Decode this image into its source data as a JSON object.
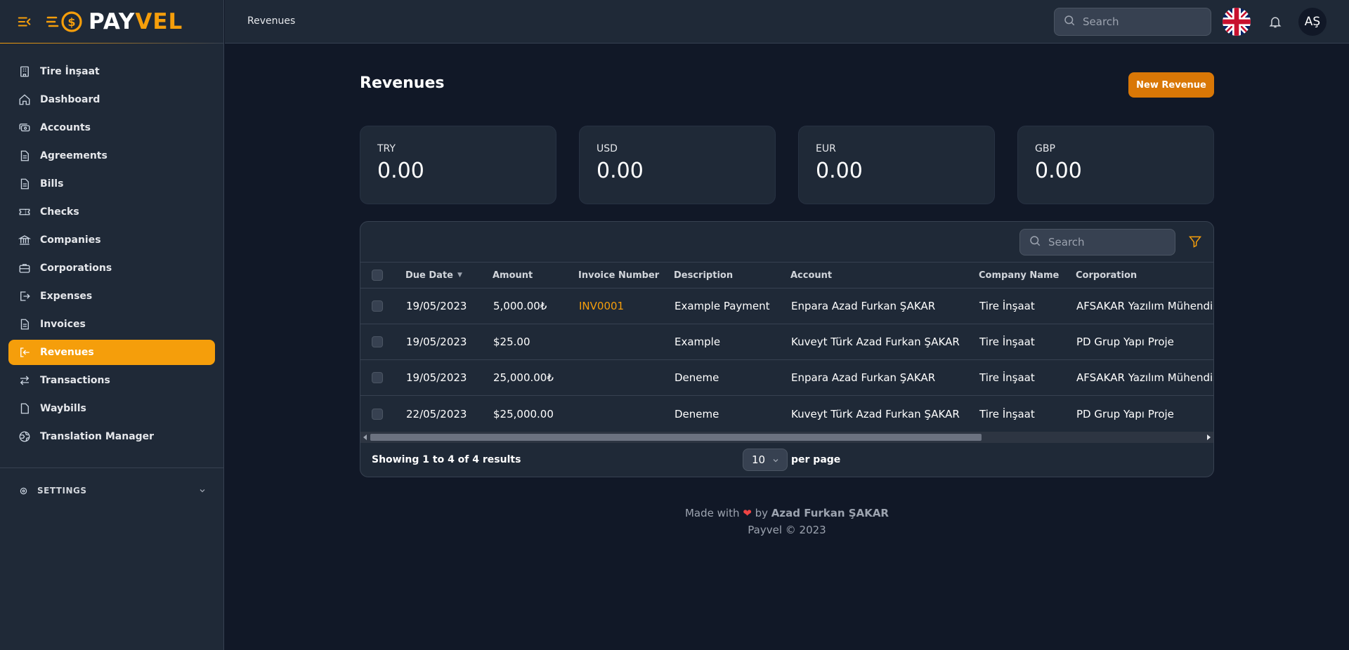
{
  "brand": {
    "pay": "PAY",
    "vel": "VEL"
  },
  "breadcrumb": "Revenues",
  "header": {
    "search_placeholder": "Search",
    "avatar_initials": "AŞ"
  },
  "sidebar": {
    "items": [
      {
        "label": "Tire İnşaat",
        "icon": "building-icon"
      },
      {
        "label": "Dashboard",
        "icon": "home-icon"
      },
      {
        "label": "Accounts",
        "icon": "cash-icon"
      },
      {
        "label": "Agreements",
        "icon": "document-icon"
      },
      {
        "label": "Bills",
        "icon": "document-icon"
      },
      {
        "label": "Checks",
        "icon": "ticket-icon"
      },
      {
        "label": "Companies",
        "icon": "library-icon"
      },
      {
        "label": "Corporations",
        "icon": "briefcase-icon"
      },
      {
        "label": "Expenses",
        "icon": "logout-icon"
      },
      {
        "label": "Invoices",
        "icon": "document-icon"
      },
      {
        "label": "Revenues",
        "icon": "receipt-icon",
        "active": true
      },
      {
        "label": "Transactions",
        "icon": "switch-icon"
      },
      {
        "label": "Waybills",
        "icon": "file-icon"
      },
      {
        "label": "Translation Manager",
        "icon": "globe-icon"
      }
    ],
    "settings_label": "SETTINGS"
  },
  "page": {
    "title": "Revenues",
    "new_button": "New Revenue"
  },
  "stats": [
    {
      "currency": "TRY",
      "value": "0.00"
    },
    {
      "currency": "USD",
      "value": "0.00"
    },
    {
      "currency": "EUR",
      "value": "0.00"
    },
    {
      "currency": "GBP",
      "value": "0.00"
    }
  ],
  "table": {
    "search_placeholder": "Search",
    "columns": [
      "Due Date",
      "Amount",
      "Invoice Number",
      "Description",
      "Account",
      "Company Name",
      "Corporation"
    ],
    "rows": [
      [
        "19/05/2023",
        "5,000.00₺",
        "INV0001",
        "Example Payment",
        "Enpara Azad Furkan ŞAKAR",
        "Tire İnşaat",
        "AFSAKAR Yazılım Mühendis"
      ],
      [
        "19/05/2023",
        "$25.00",
        "",
        "Example",
        "Kuveyt Türk Azad Furkan ŞAKAR",
        "Tire İnşaat",
        "PD Grup Yapı Proje"
      ],
      [
        "19/05/2023",
        "25,000.00₺",
        "",
        "Deneme",
        "Enpara Azad Furkan ŞAKAR",
        "Tire İnşaat",
        "AFSAKAR Yazılım Mühendis"
      ],
      [
        "22/05/2023",
        "$25,000.00",
        "",
        "Deneme",
        "Kuveyt Türk Azad Furkan ŞAKAR",
        "Tire İnşaat",
        "PD Grup Yapı Proje"
      ]
    ],
    "showing": "Showing 1 to 4 of 4 results",
    "per_page_value": "10",
    "per_page_label": "per page"
  },
  "footer": {
    "made_with": "Made with",
    "by": "by",
    "author": "Azad Furkan ŞAKAR",
    "copyright": "Payvel © 2023"
  },
  "colors": {
    "accent": "#f59e0b",
    "background": "#111827",
    "panel": "#1f2937"
  }
}
